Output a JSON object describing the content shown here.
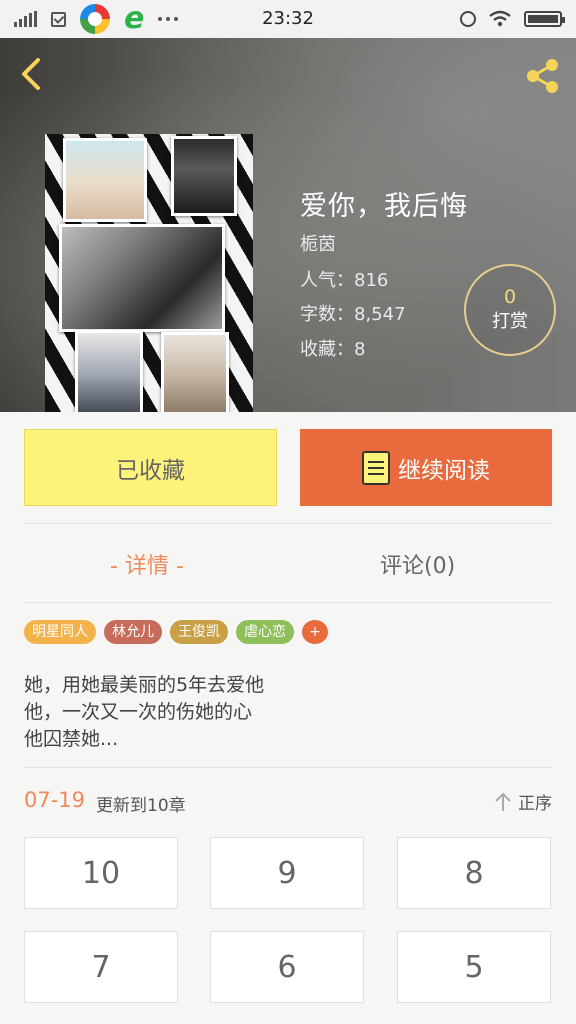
{
  "status_bar": {
    "time": "23:32"
  },
  "book": {
    "title": "爱你，我后悔",
    "author": "栀茵",
    "popularity": "人气：816",
    "word_count": "字数：8,547",
    "favorites": "收藏：8"
  },
  "tip": {
    "count": "0",
    "label": "打赏"
  },
  "actions": {
    "favorited_label": "已收藏",
    "read_label": "继续阅读"
  },
  "tabs": [
    {
      "label": "- 详情 -",
      "active": true
    },
    {
      "label": "评论(0)",
      "active": false
    }
  ],
  "tags": [
    {
      "label": "明星同人",
      "color": "#f4b24a"
    },
    {
      "label": "林允儿",
      "color": "#c76b5a"
    },
    {
      "label": "王俊凯",
      "color": "#c9a045"
    },
    {
      "label": "虐心恋",
      "color": "#8fbf5a"
    }
  ],
  "tag_add_label": "+",
  "description": [
    "她，用她最美丽的5年去爱他",
    "他，一次又一次的伤她的心",
    "他囚禁她..."
  ],
  "update": {
    "date": "07-19",
    "text": "更新到10章",
    "sort_label": "正序"
  },
  "chapters": [
    "10",
    "9",
    "8",
    "7",
    "6",
    "5"
  ],
  "colors": {
    "accent": "#e96a3c",
    "favorite_bg": "#fdf27a",
    "active_tab": "#f08a5a"
  },
  "icons": {
    "back": "chevron-left-icon",
    "share": "share-icon",
    "read": "book-icon",
    "sort": "arrow-up-icon"
  }
}
